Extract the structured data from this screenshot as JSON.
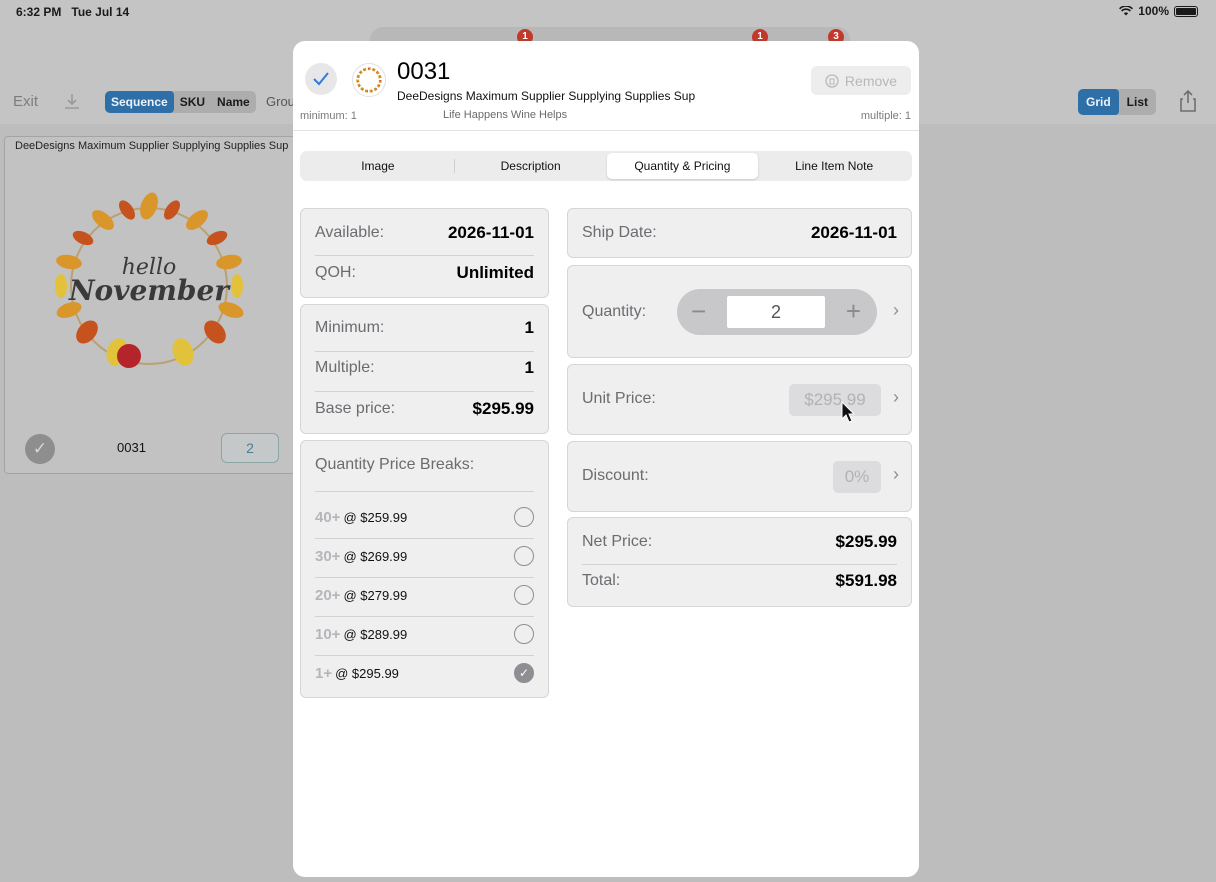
{
  "status": {
    "time": "6:32 PM",
    "date": "Tue Jul 14",
    "battery": "100%"
  },
  "background": {
    "badges": [
      "1",
      "1",
      "3"
    ],
    "exit_label": "Exit",
    "sort_options": [
      "Sequence",
      "SKU",
      "Name"
    ],
    "group_label": "Grou",
    "view_options": [
      "Grid",
      "List"
    ],
    "card": {
      "title": "DeeDesigns Maximum Supplier Supplying Supplies Sup",
      "sku": "0031",
      "qty": "2",
      "image_text": [
        "hello",
        "November"
      ]
    }
  },
  "modal": {
    "sku": "0031",
    "supplier": "DeeDesigns Maximum Supplier Supplying Supplies Sup",
    "subtitle": "Life Happens Wine Helps",
    "minimum_note": "minimum: 1",
    "multiple_note": "multiple: 1",
    "remove_label": "Remove",
    "tabs": [
      "Image",
      "Description",
      "Quantity & Pricing",
      "Line Item Note"
    ],
    "active_tab": "Quantity & Pricing",
    "availability": {
      "available_label": "Available:",
      "available_value": "2026-11-01",
      "qoh_label": "QOH:",
      "qoh_value": "Unlimited"
    },
    "ordering": {
      "minimum_label": "Minimum:",
      "minimum_value": "1",
      "multiple_label": "Multiple:",
      "multiple_value": "1",
      "base_label": "Base price:",
      "base_value": "$295.99"
    },
    "breaks": {
      "title": "Quantity Price Breaks:",
      "items": [
        {
          "qty": "40+",
          "price": "@ $259.99",
          "selected": false
        },
        {
          "qty": "30+",
          "price": "@ $269.99",
          "selected": false
        },
        {
          "qty": "20+",
          "price": "@ $279.99",
          "selected": false
        },
        {
          "qty": "10+",
          "price": "@ $289.99",
          "selected": false
        },
        {
          "qty": "1+",
          "price": "@ $295.99",
          "selected": true
        }
      ]
    },
    "ship": {
      "label": "Ship Date:",
      "value": "2026-11-01"
    },
    "quantity": {
      "label": "Quantity:",
      "value": "2",
      "minus": "−",
      "plus": "+"
    },
    "unit_price": {
      "label": "Unit Price:",
      "value": "$295.99"
    },
    "discount": {
      "label": "Discount:",
      "value": "0%"
    },
    "totals": {
      "net_label": "Net Price:",
      "net_value": "$295.99",
      "total_label": "Total:",
      "total_value": "$591.98"
    },
    "chevron": "›",
    "colors": {
      "accent": "#2e6fa8",
      "check": "#2f7bd6"
    }
  }
}
